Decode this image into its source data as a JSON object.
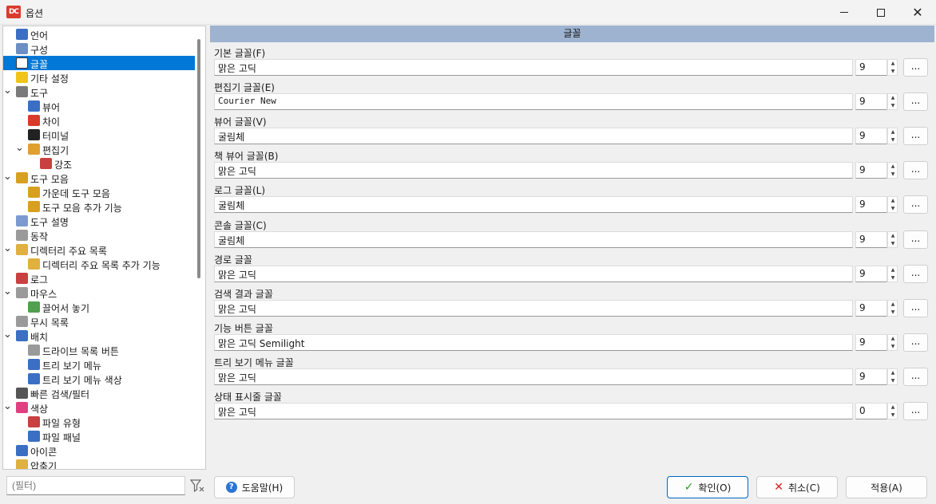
{
  "window": {
    "title": "옵션",
    "app_icon_text": "DC"
  },
  "tree": {
    "items": [
      {
        "label": "언어",
        "level": 0,
        "expanded": null,
        "icon": "flag-icon",
        "color": "#3a6fc4"
      },
      {
        "label": "구성",
        "level": 0,
        "expanded": null,
        "icon": "config-icon",
        "color": "#6b8fc4"
      },
      {
        "label": "글꼴",
        "level": 0,
        "expanded": null,
        "icon": "font-icon",
        "color": "#ffffff",
        "selected": true
      },
      {
        "label": "기타 설정",
        "level": 0,
        "expanded": null,
        "icon": "misc-icon",
        "color": "#f0c419"
      },
      {
        "label": "도구",
        "level": 0,
        "expanded": true,
        "icon": "tools-icon",
        "color": "#7a7a7a"
      },
      {
        "label": "뷰어",
        "level": 1,
        "expanded": null,
        "icon": "viewer-icon",
        "color": "#3a6fc4"
      },
      {
        "label": "차이",
        "level": 1,
        "expanded": null,
        "icon": "diff-icon",
        "color": "#d83b2b"
      },
      {
        "label": "터미널",
        "level": 1,
        "expanded": null,
        "icon": "terminal-icon",
        "color": "#222222"
      },
      {
        "label": "편집기",
        "level": 1,
        "expanded": true,
        "icon": "editor-icon",
        "color": "#e0a030"
      },
      {
        "label": "강조",
        "level": 2,
        "expanded": null,
        "icon": "highlight-icon",
        "color": "#c84040"
      },
      {
        "label": "도구 모음",
        "level": 0,
        "expanded": true,
        "icon": "toolbar-icon",
        "color": "#d8a020"
      },
      {
        "label": "가운데 도구 모음",
        "level": 1,
        "expanded": null,
        "icon": "toolbar-icon",
        "color": "#d8a020"
      },
      {
        "label": "도구 모음 추가 기능",
        "level": 1,
        "expanded": null,
        "icon": "toolbar-icon",
        "color": "#d8a020"
      },
      {
        "label": "도구 설명",
        "level": 0,
        "expanded": null,
        "icon": "tooltip-icon",
        "color": "#7a9ad0"
      },
      {
        "label": "동작",
        "level": 0,
        "expanded": null,
        "icon": "behavior-icon",
        "color": "#9a9a9a"
      },
      {
        "label": "디렉터리 주요 목록",
        "level": 0,
        "expanded": true,
        "icon": "folder-icon",
        "color": "#e0b040"
      },
      {
        "label": "디렉터리 주요 목록 추가 기능",
        "level": 1,
        "expanded": null,
        "icon": "folder-icon",
        "color": "#e0b040"
      },
      {
        "label": "로그",
        "level": 0,
        "expanded": null,
        "icon": "log-icon",
        "color": "#c84040"
      },
      {
        "label": "마우스",
        "level": 0,
        "expanded": true,
        "icon": "mouse-icon",
        "color": "#9a9a9a"
      },
      {
        "label": "끌어서 놓기",
        "level": 1,
        "expanded": null,
        "icon": "drag-drop-icon",
        "color": "#50a050"
      },
      {
        "label": "무시 목록",
        "level": 0,
        "expanded": null,
        "icon": "ignore-list-icon",
        "color": "#9a9a9a"
      },
      {
        "label": "배치",
        "level": 0,
        "expanded": true,
        "icon": "layout-icon",
        "color": "#3a6fc4"
      },
      {
        "label": "드라이브 목록 버튼",
        "level": 1,
        "expanded": null,
        "icon": "drive-icon",
        "color": "#9a9a9a"
      },
      {
        "label": "트리 보기 메뉴",
        "level": 1,
        "expanded": null,
        "icon": "treeview-icon",
        "color": "#3a6fc4"
      },
      {
        "label": "트리 보기 메뉴 색상",
        "level": 1,
        "expanded": null,
        "icon": "treeview-icon",
        "color": "#3a6fc4"
      },
      {
        "label": "빠른 검색/필터",
        "level": 0,
        "expanded": null,
        "icon": "binoculars-icon",
        "color": "#555555"
      },
      {
        "label": "색상",
        "level": 0,
        "expanded": true,
        "icon": "color-wheel-icon",
        "color": "#e04080"
      },
      {
        "label": "파일 유형",
        "level": 1,
        "expanded": null,
        "icon": "file-type-icon",
        "color": "#c84040"
      },
      {
        "label": "파일 패널",
        "level": 1,
        "expanded": null,
        "icon": "file-panel-icon",
        "color": "#3a6fc4"
      },
      {
        "label": "아이콘",
        "level": 0,
        "expanded": null,
        "icon": "footprints-icon",
        "color": "#3a6fc4"
      },
      {
        "label": "압축기",
        "level": 0,
        "expanded": null,
        "icon": "archive-icon",
        "color": "#e0b040"
      }
    ]
  },
  "filter": {
    "placeholder": "(필터)"
  },
  "section": {
    "title": "글꼴"
  },
  "fonts": [
    {
      "label": "기본 글꼴(F)",
      "name": "맑은 고딕",
      "size": "9",
      "mono": false
    },
    {
      "label": "편집기 글꼴(E)",
      "name": "Courier New",
      "size": "9",
      "mono": true
    },
    {
      "label": "뷰어 글꼴(V)",
      "name": "굴림체",
      "size": "9",
      "mono": false
    },
    {
      "label": "책 뷰어 글꼴(B)",
      "name": "맑은 고딕",
      "size": "9",
      "mono": false
    },
    {
      "label": "로그 글꼴(L)",
      "name": "굴림체",
      "size": "9",
      "mono": false
    },
    {
      "label": "콘솔 글꼴(C)",
      "name": "굴림체",
      "size": "9",
      "mono": false
    },
    {
      "label": "경로 글꼴",
      "name": "맑은 고딕",
      "size": "9",
      "mono": false
    },
    {
      "label": "검색 결과 글꼴",
      "name": "맑은 고딕",
      "size": "9",
      "mono": false
    },
    {
      "label": "기능 버튼 글꼴",
      "name": "맑은 고딕 Semilight",
      "size": "9",
      "mono": false
    },
    {
      "label": "트리 보기 메뉴 글꼴",
      "name": "맑은 고딕",
      "size": "9",
      "mono": false
    },
    {
      "label": "상태 표시줄 글꼴",
      "name": "맑은 고딕",
      "size": "0",
      "mono": false
    }
  ],
  "font_browse_label": "...",
  "buttons": {
    "help": "도움말(H)",
    "ok": "확인(O)",
    "cancel": "취소(C)",
    "apply": "적용(A)"
  },
  "colors": {
    "accent": "#0078d7",
    "header": "#9db3d0"
  }
}
